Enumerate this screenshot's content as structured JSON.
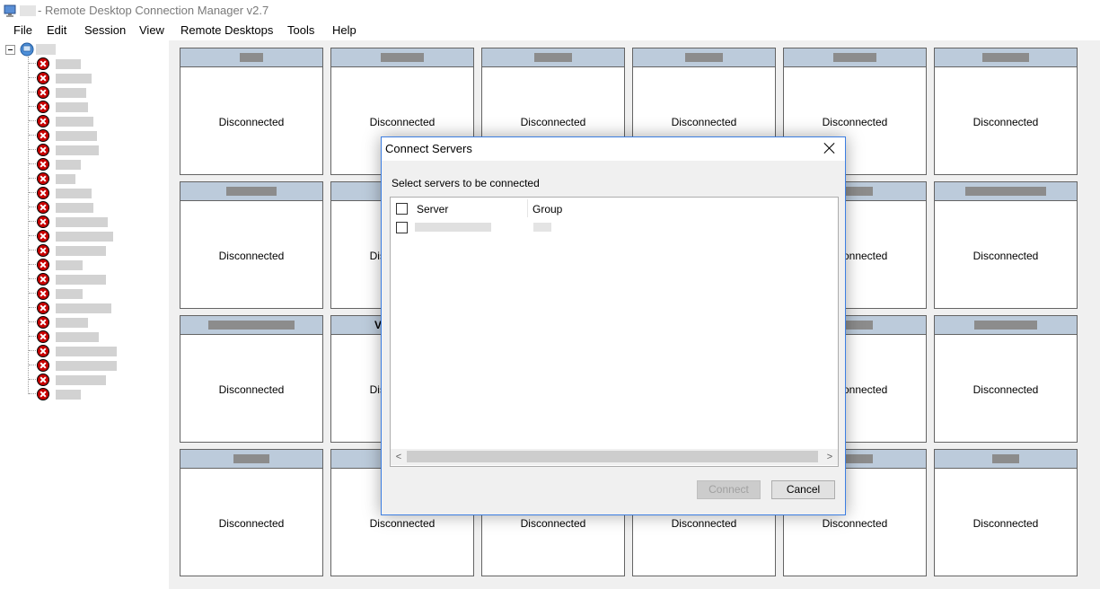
{
  "window": {
    "title": "- Remote Desktop Connection Manager v2.7"
  },
  "menu": [
    "File",
    "Edit",
    "Session",
    "View",
    "Remote Desktops",
    "Tools",
    "Help"
  ],
  "tree": {
    "item_count": 24,
    "status_icon": "disconnected-x-icon"
  },
  "tiles": {
    "status_label": "Disconnected",
    "partial_header_letter": "V"
  },
  "dialog": {
    "title": "Connect Servers",
    "instruction": "Select servers to be connected",
    "columns": {
      "server": "Server",
      "group": "Group"
    },
    "buttons": {
      "connect": "Connect",
      "cancel": "Cancel"
    },
    "scroll_left": "<",
    "scroll_right": ">"
  },
  "colors": {
    "tile_header": "#bccbdb",
    "disconnected_icon": "#c80000",
    "dialog_border": "#3c7ee2"
  }
}
